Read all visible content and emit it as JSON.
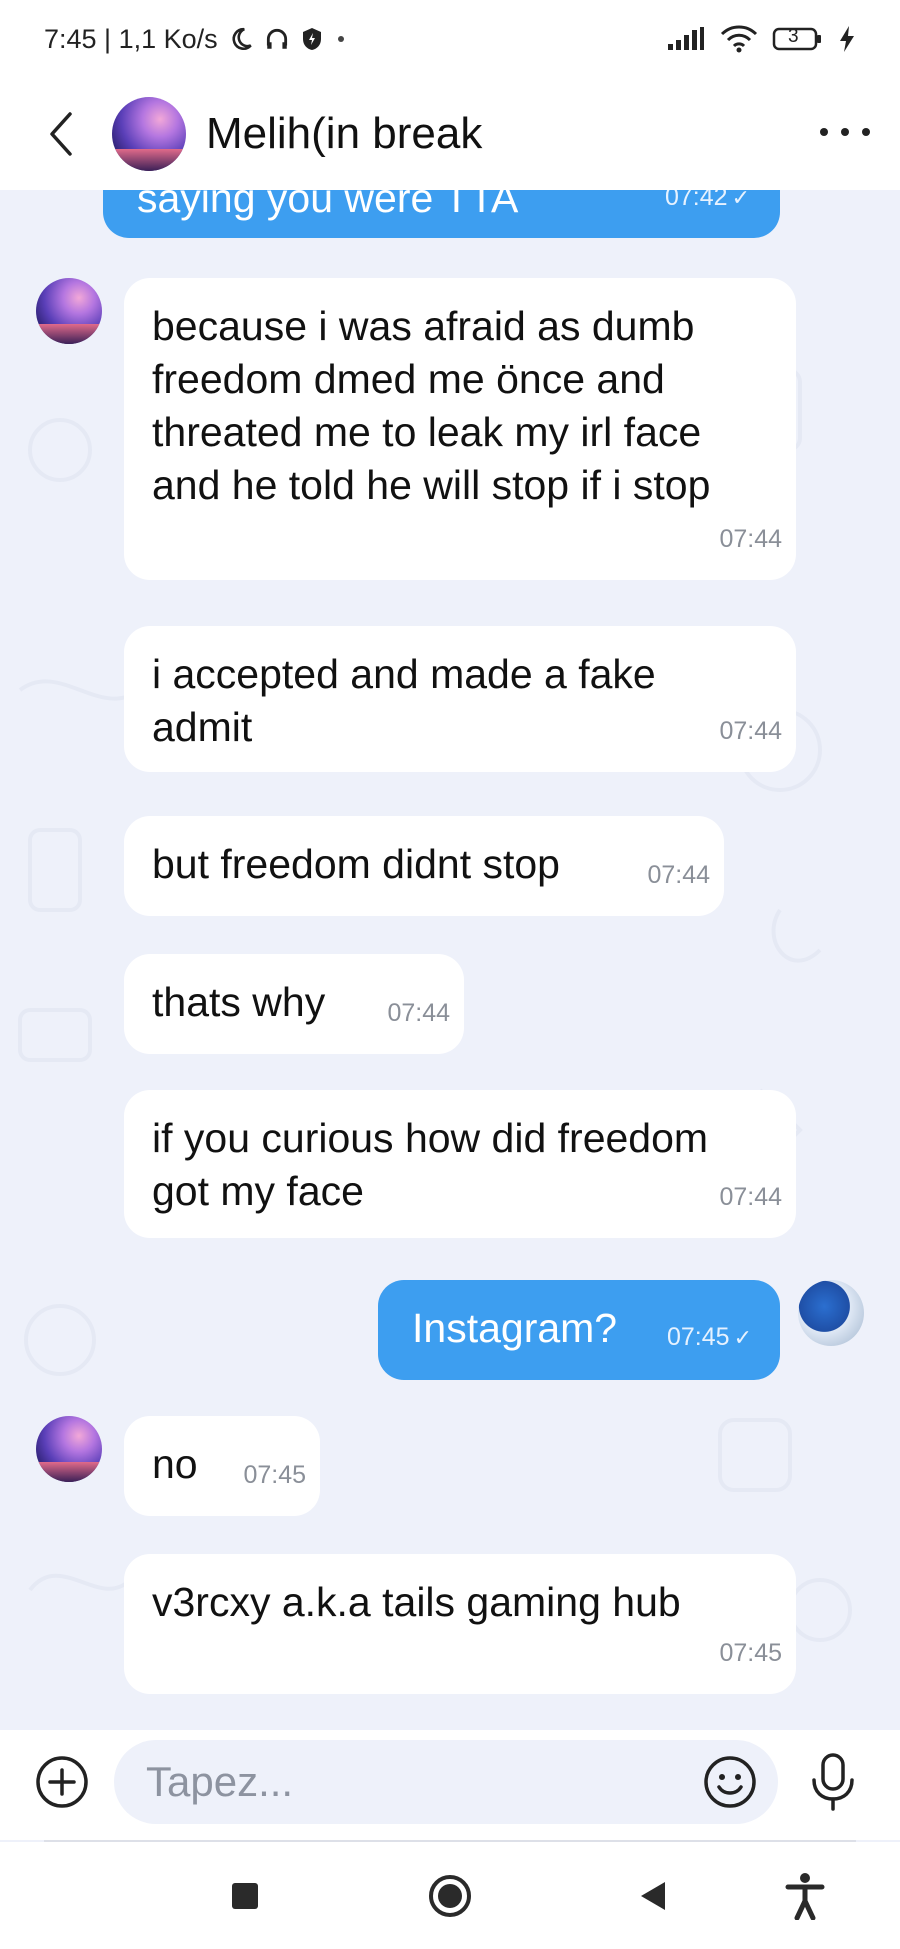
{
  "status_bar": {
    "time_speed": "7:45 | 1,1 Ko/s",
    "battery": "3"
  },
  "header": {
    "contact_name": "Melih(in break"
  },
  "messages": [
    {
      "direction": "out",
      "text": "saying you were TTA",
      "time": "07:42",
      "read": true
    },
    {
      "direction": "in",
      "text": "because i was afraid as dumb freedom dmed me önce and threated me to leak my irl face and he told he will stop if i stop",
      "time": "07:44"
    },
    {
      "direction": "in",
      "text": "i accepted and made a fake admit",
      "time": "07:44"
    },
    {
      "direction": "in",
      "text": "but freedom didnt stop",
      "time": "07:44"
    },
    {
      "direction": "in",
      "text": "thats why",
      "time": "07:44"
    },
    {
      "direction": "in",
      "text": "if you curious how did freedom got my face",
      "time": "07:44"
    },
    {
      "direction": "out",
      "text": "Instagram?",
      "time": "07:45",
      "read": true
    },
    {
      "direction": "in",
      "text": "no",
      "time": "07:45"
    },
    {
      "direction": "in",
      "text": "v3rcxy a.k.a tails gaming hub",
      "time": "07:45"
    }
  ],
  "composer": {
    "placeholder": "Tapez..."
  },
  "colors": {
    "outgoing_bubble": "#3d9ef0",
    "incoming_bubble": "#ffffff",
    "chat_background": "#eef1fa"
  },
  "icons": {
    "back": "chevron-left-icon",
    "more": "more-dots-icon",
    "attach": "plus-circle-icon",
    "emoji": "smiley-icon",
    "mic": "microphone-icon",
    "nav_recent": "square-icon",
    "nav_home": "circle-icon",
    "nav_back": "triangle-back-icon",
    "accessibility": "accessibility-icon"
  }
}
